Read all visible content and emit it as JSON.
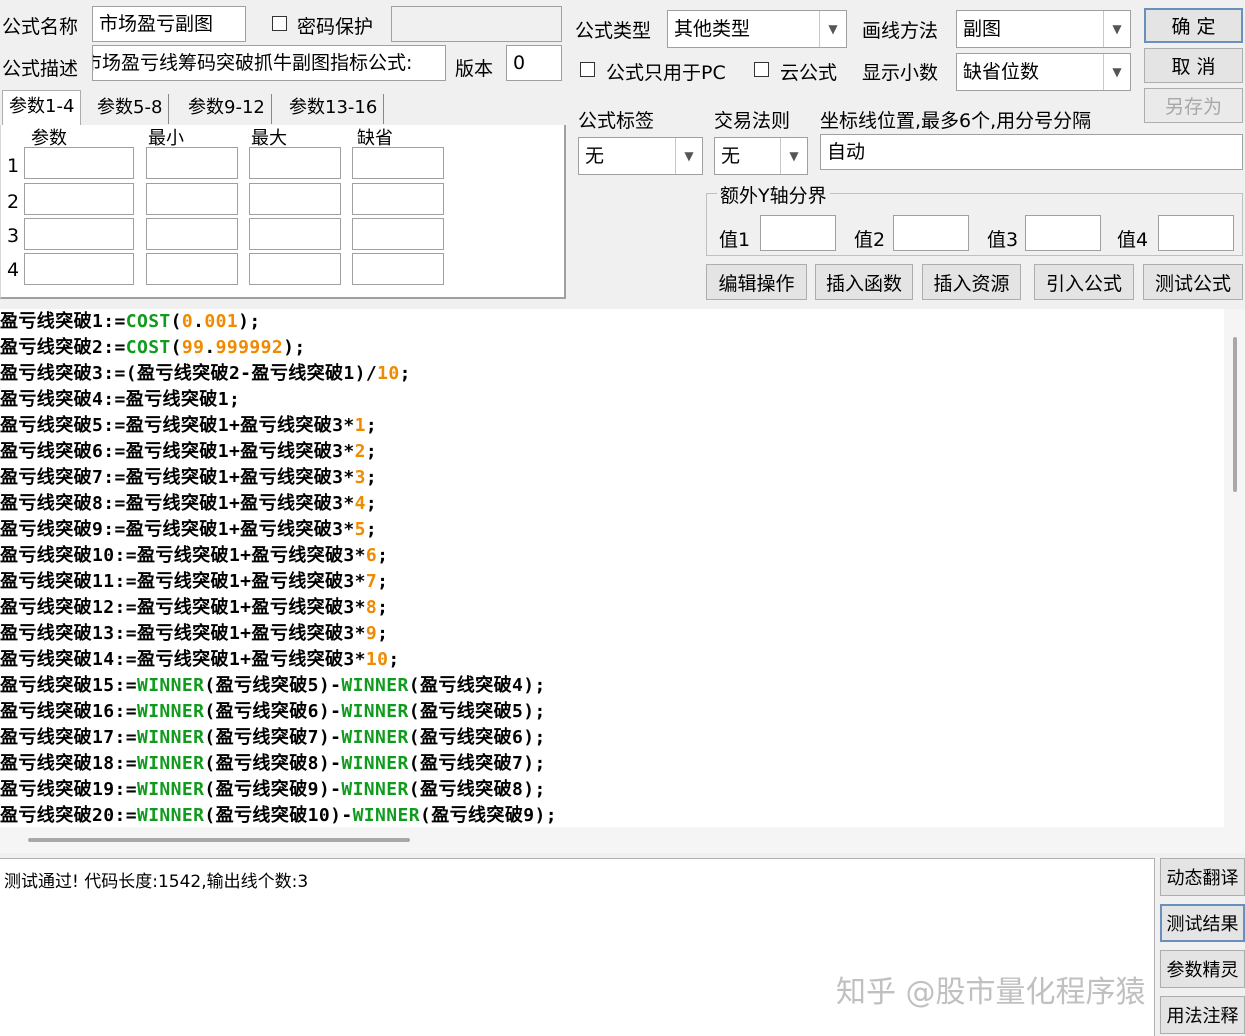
{
  "form": {
    "name_label": "公式名称",
    "name_value": "市场盈亏副图",
    "password_label": "密码保护",
    "desc_label": "公式描述",
    "desc_value": "市场盈亏线筹码突破抓牛副图指标公式:",
    "version_label": "版本",
    "version_value": "0",
    "type_label": "公式类型",
    "type_value": "其他类型",
    "draw_label": "画线方法",
    "draw_value": "副图",
    "pc_only_label": "公式只用于PC",
    "cloud_label": "云公式",
    "decimals_label": "显示小数",
    "decimals_value": "缺省位数",
    "tag_label": "公式标签",
    "tag_value": "无",
    "trade_label": "交易法则",
    "trade_value": "无",
    "coord_label": "坐标线位置,最多6个,用分号分隔",
    "coord_value": "自动",
    "extra_y_label": "额外Y轴分界",
    "val1_label": "值1",
    "val2_label": "值2",
    "val3_label": "值3",
    "val4_label": "值4"
  },
  "buttons": {
    "ok": "确 定",
    "cancel": "取 消",
    "save_as": "另存为",
    "edit_ops": "编辑操作",
    "insert_func": "插入函数",
    "insert_res": "插入资源",
    "import": "引入公式",
    "test": "测试公式",
    "dyn_translate": "动态翻译",
    "test_result": "测试结果",
    "param_wizard": "参数精灵",
    "usage_notes": "用法注释"
  },
  "tabs": [
    "参数1-4",
    "参数5-8",
    "参数9-12",
    "参数13-16"
  ],
  "params": {
    "headers": [
      "参数",
      "最小",
      "最大",
      "缺省"
    ],
    "rows": [
      "1",
      "2",
      "3",
      "4"
    ]
  },
  "code": [
    [
      [
        "t",
        "盈亏线突破1:="
      ],
      [
        "f",
        "COST"
      ],
      [
        "t",
        "("
      ],
      [
        "n",
        "0"
      ],
      [
        "t",
        "."
      ],
      [
        "n",
        "001"
      ],
      [
        "t",
        ");"
      ]
    ],
    [
      [
        "t",
        "盈亏线突破2:="
      ],
      [
        "f",
        "COST"
      ],
      [
        "t",
        "("
      ],
      [
        "n",
        "99"
      ],
      [
        "t",
        "."
      ],
      [
        "n",
        "999992"
      ],
      [
        "t",
        ");"
      ]
    ],
    [
      [
        "t",
        "盈亏线突破3:=(盈亏线突破2-盈亏线突破1)/"
      ],
      [
        "n",
        "10"
      ],
      [
        "t",
        ";"
      ]
    ],
    [
      [
        "t",
        "盈亏线突破4:=盈亏线突破1;"
      ]
    ],
    [
      [
        "t",
        "盈亏线突破5:=盈亏线突破1+盈亏线突破3*"
      ],
      [
        "n",
        "1"
      ],
      [
        "t",
        ";"
      ]
    ],
    [
      [
        "t",
        "盈亏线突破6:=盈亏线突破1+盈亏线突破3*"
      ],
      [
        "n",
        "2"
      ],
      [
        "t",
        ";"
      ]
    ],
    [
      [
        "t",
        "盈亏线突破7:=盈亏线突破1+盈亏线突破3*"
      ],
      [
        "n",
        "3"
      ],
      [
        "t",
        ";"
      ]
    ],
    [
      [
        "t",
        "盈亏线突破8:=盈亏线突破1+盈亏线突破3*"
      ],
      [
        "n",
        "4"
      ],
      [
        "t",
        ";"
      ]
    ],
    [
      [
        "t",
        "盈亏线突破9:=盈亏线突破1+盈亏线突破3*"
      ],
      [
        "n",
        "5"
      ],
      [
        "t",
        ";"
      ]
    ],
    [
      [
        "t",
        "盈亏线突破10:=盈亏线突破1+盈亏线突破3*"
      ],
      [
        "n",
        "6"
      ],
      [
        "t",
        ";"
      ]
    ],
    [
      [
        "t",
        "盈亏线突破11:=盈亏线突破1+盈亏线突破3*"
      ],
      [
        "n",
        "7"
      ],
      [
        "t",
        ";"
      ]
    ],
    [
      [
        "t",
        "盈亏线突破12:=盈亏线突破1+盈亏线突破3*"
      ],
      [
        "n",
        "8"
      ],
      [
        "t",
        ";"
      ]
    ],
    [
      [
        "t",
        "盈亏线突破13:=盈亏线突破1+盈亏线突破3*"
      ],
      [
        "n",
        "9"
      ],
      [
        "t",
        ";"
      ]
    ],
    [
      [
        "t",
        "盈亏线突破14:=盈亏线突破1+盈亏线突破3*"
      ],
      [
        "n",
        "10"
      ],
      [
        "t",
        ";"
      ]
    ],
    [
      [
        "t",
        "盈亏线突破15:="
      ],
      [
        "f",
        "WINNER"
      ],
      [
        "t",
        "(盈亏线突破5)-"
      ],
      [
        "f",
        "WINNER"
      ],
      [
        "t",
        "(盈亏线突破4);"
      ]
    ],
    [
      [
        "t",
        "盈亏线突破16:="
      ],
      [
        "f",
        "WINNER"
      ],
      [
        "t",
        "(盈亏线突破6)-"
      ],
      [
        "f",
        "WINNER"
      ],
      [
        "t",
        "(盈亏线突破5);"
      ]
    ],
    [
      [
        "t",
        "盈亏线突破17:="
      ],
      [
        "f",
        "WINNER"
      ],
      [
        "t",
        "(盈亏线突破7)-"
      ],
      [
        "f",
        "WINNER"
      ],
      [
        "t",
        "(盈亏线突破6);"
      ]
    ],
    [
      [
        "t",
        "盈亏线突破18:="
      ],
      [
        "f",
        "WINNER"
      ],
      [
        "t",
        "(盈亏线突破8)-"
      ],
      [
        "f",
        "WINNER"
      ],
      [
        "t",
        "(盈亏线突破7);"
      ]
    ],
    [
      [
        "t",
        "盈亏线突破19:="
      ],
      [
        "f",
        "WINNER"
      ],
      [
        "t",
        "(盈亏线突破9)-"
      ],
      [
        "f",
        "WINNER"
      ],
      [
        "t",
        "(盈亏线突破8);"
      ]
    ],
    [
      [
        "t",
        "盈亏线突破20:="
      ],
      [
        "f",
        "WINNER"
      ],
      [
        "t",
        "(盈亏线突破10)-"
      ],
      [
        "f",
        "WINNER"
      ],
      [
        "t",
        "(盈亏线突破9);"
      ]
    ]
  ],
  "status": {
    "message": "测试通过! 代码长度:1542,输出线个数:3"
  },
  "watermark": "知乎 @股市量化程序猿",
  "colors": {
    "function": "#119b1e",
    "number": "#f08a00"
  }
}
